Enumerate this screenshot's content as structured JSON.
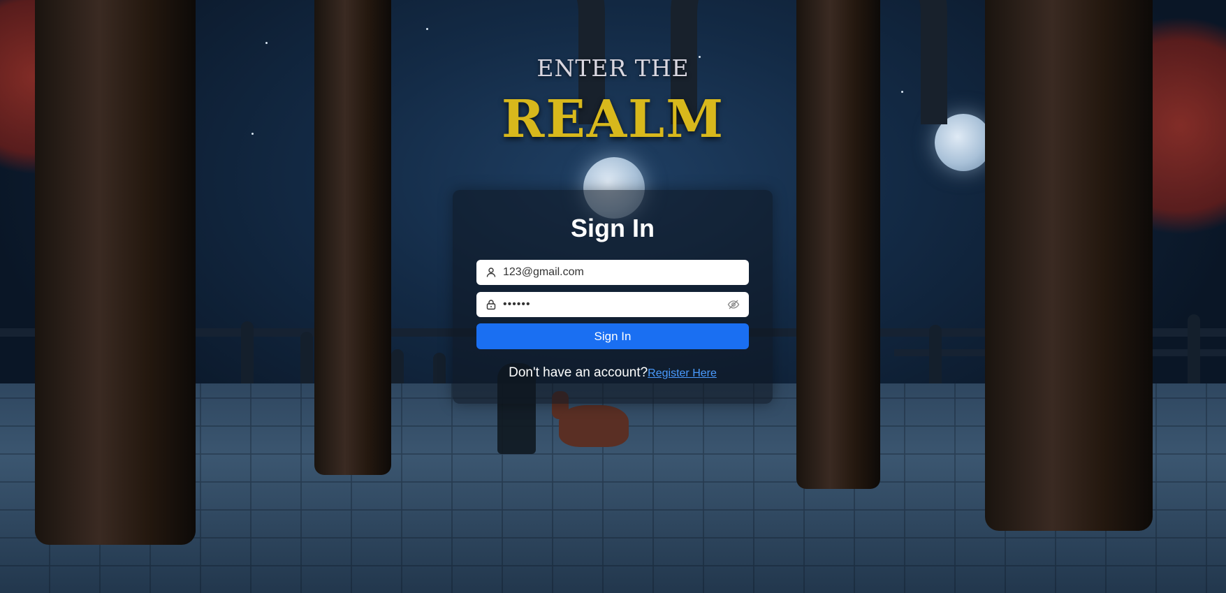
{
  "header": {
    "title_top": "ENTER THE",
    "title_main": "REALM"
  },
  "signin": {
    "heading": "Sign In",
    "email_value": "123@gmail.com",
    "password_value": "••••••",
    "submit_label": "Sign In",
    "no_account_text": "Don't have an account?",
    "register_link": "Register Here"
  },
  "icons": {
    "user": "user-icon",
    "lock": "lock-icon",
    "toggle_visibility": "eye-slash-icon"
  },
  "colors": {
    "title_gold": "#d8b81c",
    "button_blue": "#1a6ff2",
    "link_blue": "#4a9bff"
  }
}
